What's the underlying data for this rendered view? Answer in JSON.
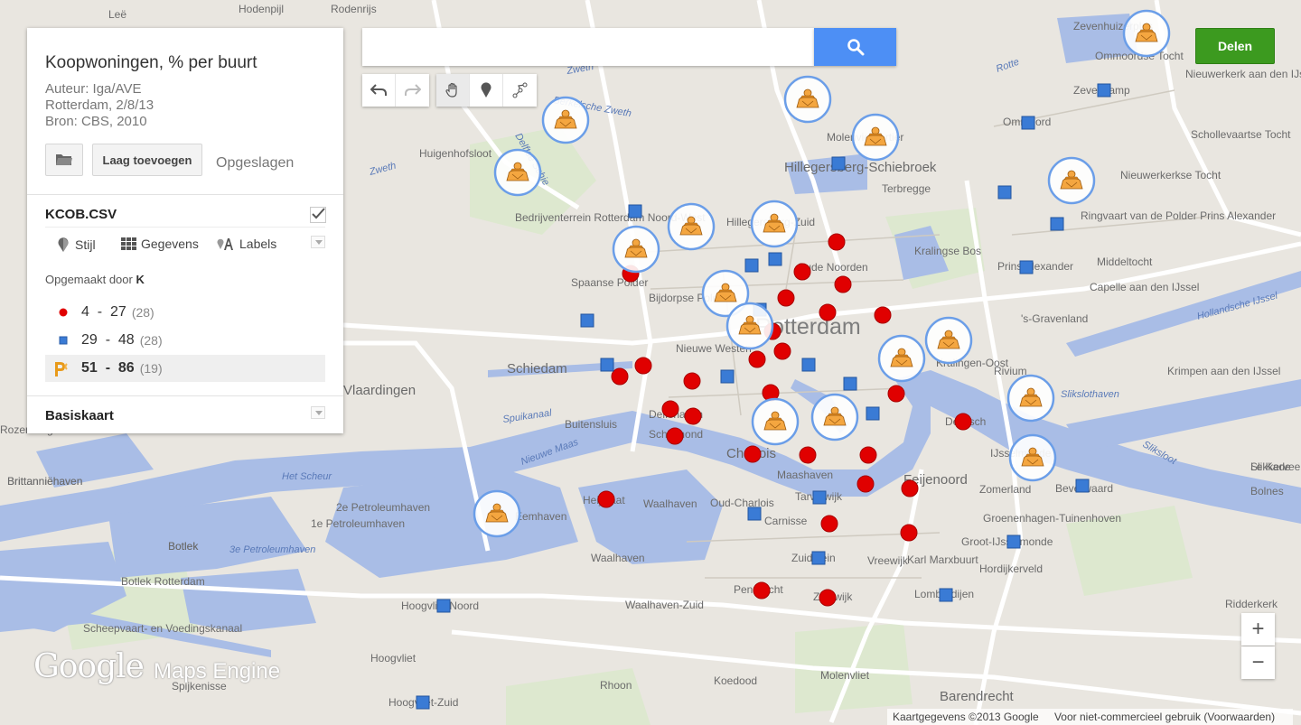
{
  "map": {
    "colors": {
      "land": "#e9e6e0",
      "water": "#a9bde6",
      "park": "#dde8cf",
      "road": "#ffffff",
      "red_marker": "#e00000",
      "blue_marker": "#3a7bd5",
      "icon_ring": "#6b9ee8",
      "icon_fill": "#f4a640"
    },
    "labels": [
      {
        "text": "Leë"
      },
      {
        "text": "Hodenpijl"
      },
      {
        "text": "Rodenrijs"
      },
      {
        "text": "Zevenhuizerplas"
      },
      {
        "text": "Ommoordse Tocht"
      },
      {
        "text": "Zweth"
      },
      {
        "text": "Berkelsche Zweth"
      },
      {
        "text": "Huigenhofsloot"
      },
      {
        "text": "Delftse Schie"
      },
      {
        "text": "Zweth"
      },
      {
        "text": "Molenviervartier"
      },
      {
        "text": "Hillegersberg-Schiebroek"
      },
      {
        "text": "Terbregge"
      },
      {
        "text": "Ommoord"
      },
      {
        "text": "Zevenkamp"
      },
      {
        "text": "Nieuwerkerk aan den IJssel"
      },
      {
        "text": "Schollevaartse Tocht"
      },
      {
        "text": "Nieuwerkerkse Tocht"
      },
      {
        "text": "Rotte"
      },
      {
        "text": "Bedrijventerrein Rotterdam Noord-West"
      },
      {
        "text": "Hillegersberg-Zuid"
      },
      {
        "text": "Kralingse Bos"
      },
      {
        "text": "Ringvaart van de Polder Prins Alexander"
      },
      {
        "text": "Prins Alexander"
      },
      {
        "text": "Middeltocht"
      },
      {
        "text": "Capelle aan den IJssel"
      },
      {
        "text": "Spaanse Polder"
      },
      {
        "text": "Bijdorpse Polder"
      },
      {
        "text": "Oude Noorden"
      },
      {
        "text": "Rotterdam"
      },
      {
        "text": "'s-Gravenland"
      },
      {
        "text": "Hollandsche IJssel"
      },
      {
        "text": "Schiedam"
      },
      {
        "text": "Nieuwe Westen"
      },
      {
        "text": "Kralingen-Oost"
      },
      {
        "text": "Rivium"
      },
      {
        "text": "Krimpen aan den IJssel"
      },
      {
        "text": "Vlaardingen"
      },
      {
        "text": "Delfshaven"
      },
      {
        "text": "Spuikanaal"
      },
      {
        "text": "Buitensluis"
      },
      {
        "text": "Schiemond"
      },
      {
        "text": "Charlois"
      },
      {
        "text": "De Esch"
      },
      {
        "text": "Slikslothaven"
      },
      {
        "text": "Nieuwe Maas"
      },
      {
        "text": "Sliksloot"
      },
      {
        "text": "Brittanniëhaven"
      },
      {
        "text": "Het Scheur"
      },
      {
        "text": "Maashaven"
      },
      {
        "text": "Feijenoord"
      },
      {
        "text": "IJsselmonde"
      },
      {
        "text": "Zomerland"
      },
      {
        "text": "Beverwaard"
      },
      {
        "text": "Slikkerveer"
      },
      {
        "text": "Heijplaat"
      },
      {
        "text": "Waalhaven"
      },
      {
        "text": "Oud-Charlois"
      },
      {
        "text": "Tarwewijk"
      },
      {
        "text": "Groenenhagen-Tuinenhoven"
      },
      {
        "text": "2e Petroleumhaven"
      },
      {
        "text": "1e Petroleumhaven"
      },
      {
        "text": "Eemhaven"
      },
      {
        "text": "Carnisse"
      },
      {
        "text": "Vreewijk"
      },
      {
        "text": "Groot-IJsselmonde"
      },
      {
        "text": "Botlek"
      },
      {
        "text": "3e Petroleumhaven"
      },
      {
        "text": "Zuidplein"
      },
      {
        "text": "Karl Marxbuurt"
      },
      {
        "text": "Hordijkerveld"
      },
      {
        "text": "Waalhaven"
      },
      {
        "text": "Botlek Rotterdam"
      },
      {
        "text": "Pendrecht"
      },
      {
        "text": "Zuidwijk"
      },
      {
        "text": "Lombardijen"
      },
      {
        "text": "Hoogvliet Noord"
      },
      {
        "text": "Waalhaven-Zuid"
      },
      {
        "text": "Ridderkerk"
      },
      {
        "text": "Scheepvaart- en Voedingskanaal"
      },
      {
        "text": "Hoogvliet"
      },
      {
        "text": "Koedood"
      },
      {
        "text": "Molenvliet"
      },
      {
        "text": "Spijkenisse"
      },
      {
        "text": "Rhoon"
      },
      {
        "text": "Barendrecht"
      },
      {
        "text": "Hoogvliet-Zuid"
      },
      {
        "text": "Le Kade"
      },
      {
        "text": "Bolnes"
      },
      {
        "text": "Rozenburg"
      },
      {
        "text": "Brittanniëhaven"
      },
      {
        "text": "Botlek"
      }
    ]
  },
  "panel": {
    "title": "Koopwoningen, % per buurt",
    "author": "Auteur: Iga/AVE",
    "place_date": "Rotterdam, 2/8/13",
    "source": "Bron: CBS, 2010",
    "add_layer": "Laag toevoegen",
    "saved": "Opgeslagen",
    "layer_name": "KCOB.CSV",
    "tools": {
      "style": "Stijl",
      "data": "Gegevens",
      "labels": "Labels"
    },
    "styled_by_prefix": "Opgemaakt door",
    "styled_by_field": "K",
    "legend": [
      {
        "min": "4",
        "max": "27",
        "count": "(28)",
        "symbol": "red-dot"
      },
      {
        "min": "29",
        "max": "48",
        "count": "(28)",
        "symbol": "blue-square"
      },
      {
        "min": "51",
        "max": "86",
        "count": "(19)",
        "symbol": "person-icon"
      }
    ],
    "basemap": "Basiskaart"
  },
  "search": {
    "value": "",
    "placeholder": ""
  },
  "share_label": "Delen",
  "zoom": {
    "in": "+",
    "out": "−"
  },
  "logo": {
    "google": "Google",
    "product": "Maps Engine"
  },
  "attribution": {
    "data": "Kaartgegevens ©2013 Google",
    "terms": "Voor niet-commercieel gebruik (Voorwaarden)"
  }
}
